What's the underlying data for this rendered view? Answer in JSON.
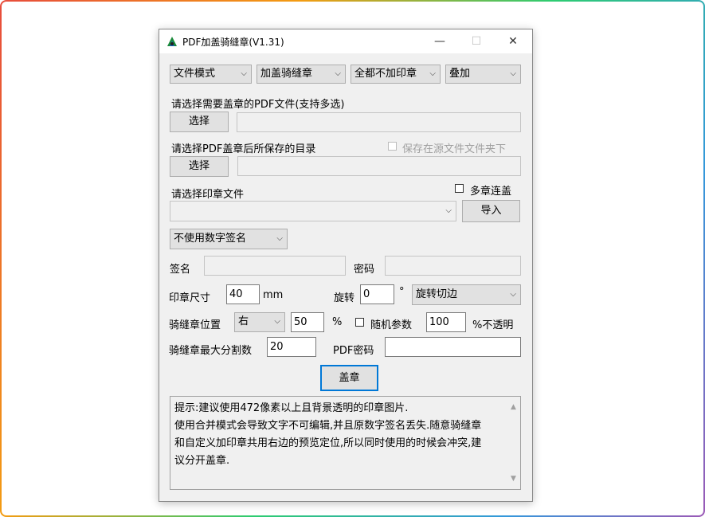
{
  "window": {
    "title": "PDF加盖骑缝章(V1.31)",
    "minimize": "—",
    "maximize": "☐",
    "close": "✕"
  },
  "toolbar": {
    "mode": "文件模式",
    "stamp_type": "加盖骑缝章",
    "apply_scope": "全都不加印章",
    "blend": "叠加"
  },
  "pdf_select": {
    "label": "请选择需要盖章的PDF文件(支持多选)",
    "button": "选择",
    "value": ""
  },
  "output_dir": {
    "label": "请选择PDF盖章后所保存的目录",
    "save_in_source": "保存在源文件文件夹下",
    "button": "选择",
    "value": ""
  },
  "stamp_file": {
    "label": "请选择印章文件",
    "multi_stamp": "多章连盖",
    "selected": "",
    "import_button": "导入"
  },
  "signature": {
    "mode": "不使用数字签名",
    "sign_label": "签名",
    "sign_value": "",
    "password_label": "密码",
    "password_value": ""
  },
  "size": {
    "label": "印章尺寸",
    "value": "40",
    "unit": "mm",
    "rotate_label": "旋转",
    "rotate_value": "0",
    "degree": "°",
    "rotate_mode": "旋转切边"
  },
  "position": {
    "label": "骑缝章位置",
    "side": "右",
    "percent": "50",
    "percent_unit": "%",
    "random": "随机参数",
    "opacity": "100",
    "opacity_unit": "%不透明"
  },
  "split": {
    "label": "骑缝章最大分割数",
    "value": "20",
    "pdf_password_label": "PDF密码",
    "pdf_password_value": ""
  },
  "action": {
    "stamp_button": "盖章"
  },
  "tips": {
    "line1": "提示:建议使用472像素以上且背景透明的印章图片.",
    "line2": "使用合并模式会导致文字不可编辑,并且原数字签名丢失.随意骑缝章",
    "line3": "和自定义加印章共用右边的预览定位,所以同时使用的时候会冲突,建",
    "line4": "议分开盖章."
  },
  "icons": {
    "app": "pdf-stamp-app-icon",
    "dropdown": "chevron-down-icon"
  }
}
